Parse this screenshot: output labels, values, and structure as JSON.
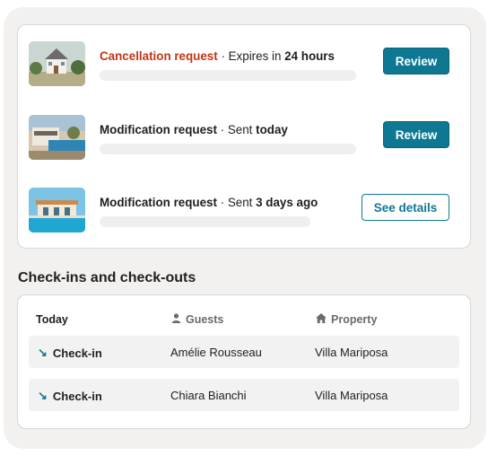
{
  "requests": [
    {
      "type": "Cancellation request",
      "separator": " · ",
      "meta": "Expires in",
      "when": "24 hours",
      "action": "Review",
      "action_style": "primary",
      "alert": true
    },
    {
      "type": "Modification request",
      "separator": " · ",
      "meta": "Sent",
      "when": "today",
      "action": "Review",
      "action_style": "primary",
      "alert": false
    },
    {
      "type": "Modification request",
      "separator": " · ",
      "meta": "Sent",
      "when": "3 days ago",
      "action": "See details",
      "action_style": "secondary",
      "alert": false
    }
  ],
  "checks": {
    "title": "Check-ins and check-outs",
    "headers": {
      "date": "Today",
      "guests": "Guests",
      "property": "Property"
    },
    "rows": [
      {
        "kind": "Check-in",
        "guest": "Amélie Rousseau",
        "property": "Villa Mariposa"
      },
      {
        "kind": "Check-in",
        "guest": "Chiara Bianchi",
        "property": "Villa Mariposa"
      }
    ]
  },
  "colors": {
    "accent": "#0e7893",
    "alert": "#c13515"
  }
}
